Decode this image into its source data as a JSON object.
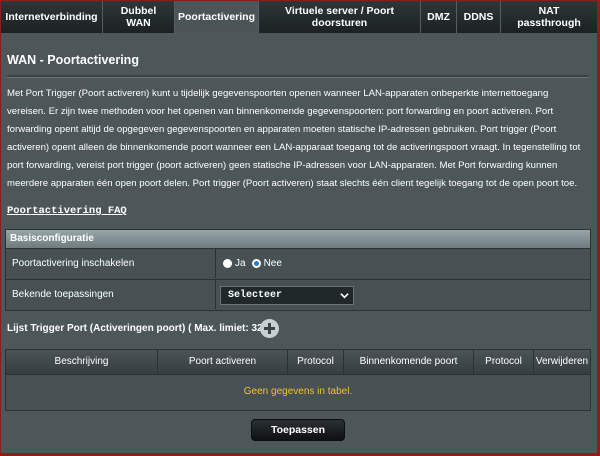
{
  "tabs": [
    {
      "label": "Internetverbinding",
      "active": false
    },
    {
      "label": "Dubbel WAN",
      "active": false
    },
    {
      "label": "Poortactivering",
      "active": true
    },
    {
      "label": "Virtuele server / Poort doorsturen",
      "active": false
    },
    {
      "label": "DMZ",
      "active": false
    },
    {
      "label": "DDNS",
      "active": false
    },
    {
      "label": "NAT passthrough",
      "active": false
    }
  ],
  "page": {
    "title": "WAN - Poortactivering",
    "description": "Met Port Trigger (Poort activeren) kunt u tijdelijk gegevenspoorten openen wanneer LAN-apparaten onbeperkte internettoegang vereisen. Er zijn twee methoden voor het openen van binnenkomende gegevenspoorten: port forwarding en poort activeren. Port forwarding opent altijd de opgegeven gegevenspoorten en apparaten moeten statische IP-adressen gebruiken. Port trigger (Poort activeren) opent alleen de binnenkomende poort wanneer een LAN-apparaat toegang tot de activeringspoort vraagt. In tegenstelling tot port forwarding, vereist port trigger (poort activeren) geen statische IP-adressen voor LAN-apparaten. Met Port forwarding kunnen meerdere apparaten één open poort delen. Port trigger (Poort activeren) staat slechts één client tegelijk toegang tot de open poort toe.",
    "faq_link": "Poortactivering FAQ"
  },
  "basic_config": {
    "header": "Basisconfiguratie",
    "enable_label": "Poortactivering inschakelen",
    "enable_options": [
      {
        "label": "Ja",
        "selected": false
      },
      {
        "label": "Nee",
        "selected": true
      }
    ],
    "apps_label": "Bekende toepassingen",
    "apps_select_value": "Selecteer"
  },
  "trigger_list": {
    "title": "Lijst Trigger Port (Activeringen poort) ( Max. limiet: 32 )",
    "columns": [
      "Beschrijving",
      "Poort activeren",
      "Protocol",
      "Binnenkomende poort",
      "Protocol",
      "Verwijderen"
    ],
    "empty_text": "Geen gegevens in tabel."
  },
  "apply_label": "Toepassen",
  "colors": {
    "accent_border": "#8a1f17",
    "empty_text": "#f2c130",
    "radio_selected": "#2b78c4"
  },
  "icons": [
    "add-circle-icon",
    "chevron-down-icon"
  ]
}
